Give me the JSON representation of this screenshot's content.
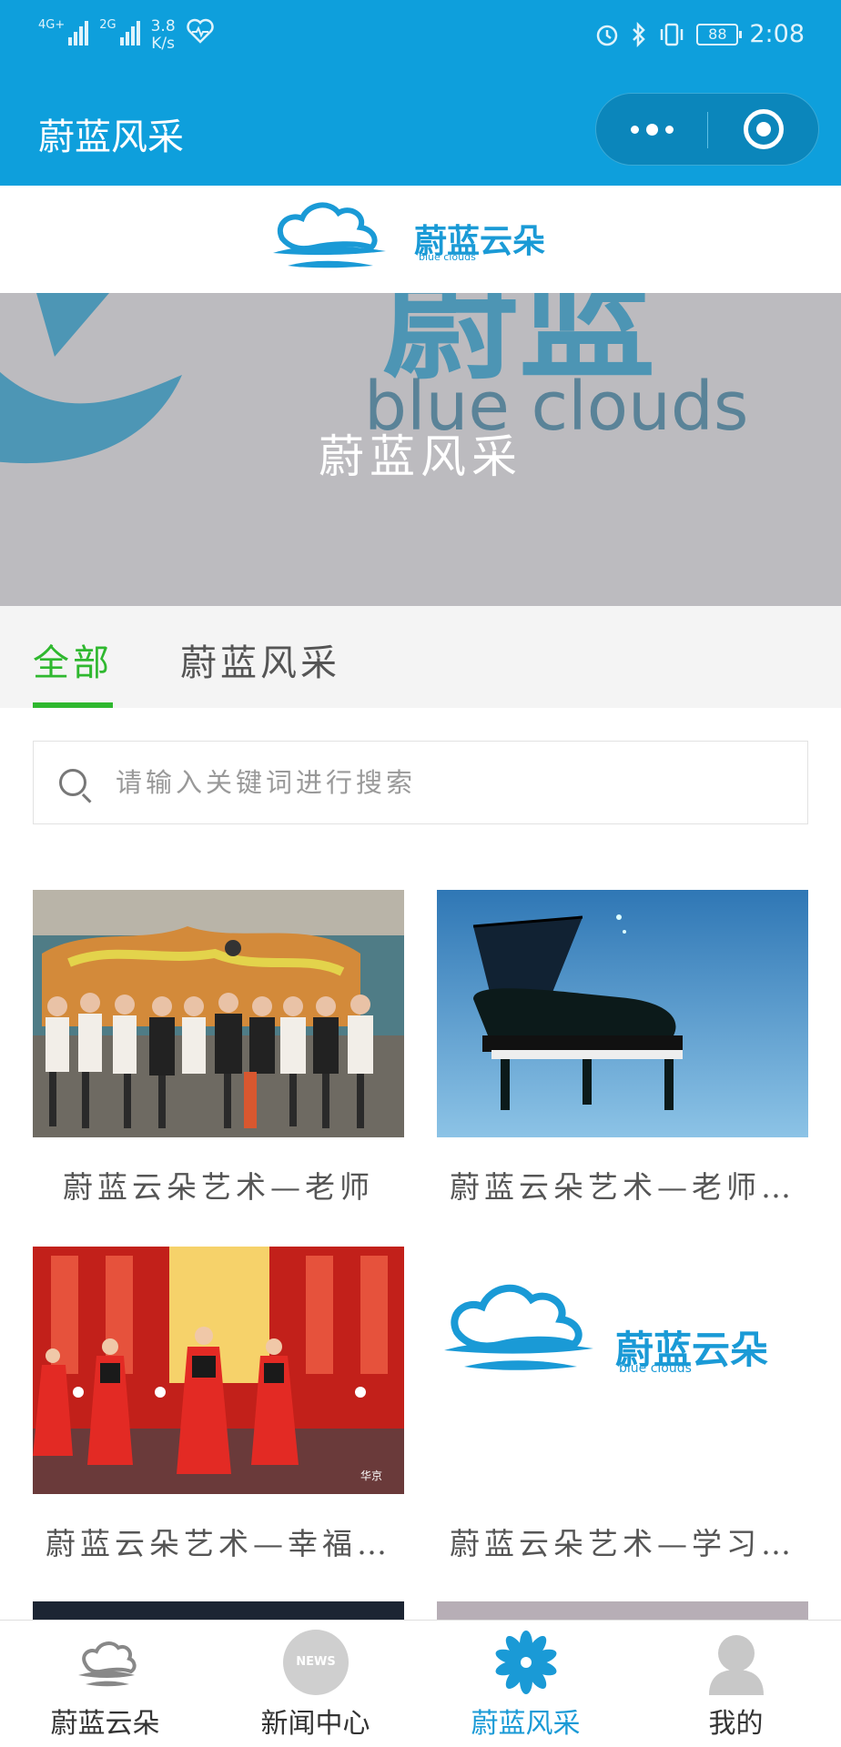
{
  "status_bar": {
    "signal1": "4G+",
    "signal2": "2G",
    "speed_value": "3.8",
    "speed_unit": "K/s",
    "battery": "88",
    "time": "2:08"
  },
  "nav": {
    "title": "蔚蓝风采"
  },
  "logo": {
    "brand": "蔚蓝云朵",
    "sub": "blue clouds"
  },
  "banner": {
    "title": "蔚蓝风采",
    "bg_word": "blue clouds",
    "bg_chars": "蔚蓝"
  },
  "tabs": [
    {
      "label": "全部",
      "active": true
    },
    {
      "label": "蔚蓝风采",
      "active": false
    }
  ],
  "search": {
    "placeholder": "请输入关键词进行搜索"
  },
  "cards": [
    {
      "title": "蔚蓝云朵艺术—老师",
      "image": "group-photo"
    },
    {
      "title": "蔚蓝云朵艺术—老师…",
      "image": "piano"
    },
    {
      "title": "蔚蓝云朵艺术—幸福…",
      "image": "dance-stage"
    },
    {
      "title": "蔚蓝云朵艺术—学习…",
      "image": "logo"
    }
  ],
  "card_logo": {
    "brand": "蔚蓝云朵",
    "sub": "blue clouds"
  },
  "tab_bar": {
    "items": [
      {
        "label": "蔚蓝云朵",
        "icon": "cloud-icon",
        "active": false
      },
      {
        "label": "新闻中心",
        "icon": "news-icon",
        "icon_text": "NEWS",
        "active": false
      },
      {
        "label": "蔚蓝风采",
        "icon": "flower-icon",
        "active": true
      },
      {
        "label": "我的",
        "icon": "user-icon",
        "active": false
      }
    ]
  },
  "colors": {
    "brand_blue": "#0e9fdc",
    "active_green": "#2fb82f",
    "tab_active_blue": "#1a9ad6"
  }
}
